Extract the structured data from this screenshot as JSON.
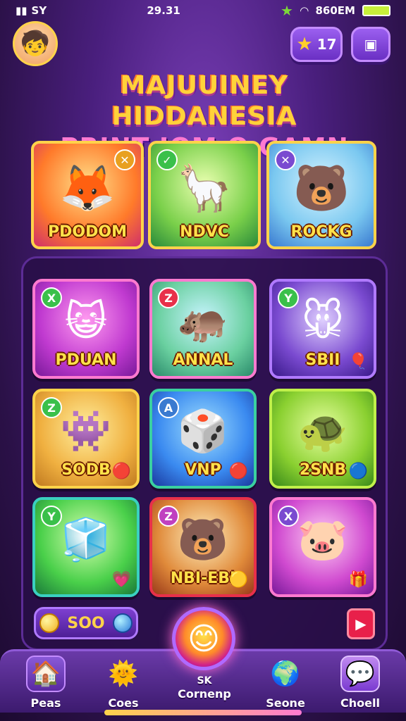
{
  "status": {
    "carrier": "SY",
    "time": "29.31",
    "battery_text": "860EM"
  },
  "header": {
    "stars_count": "17"
  },
  "title": {
    "line1": "MAJUUINEY HIDDANESIA",
    "line2": "PRINT IOM O GAMN"
  },
  "featured": [
    {
      "label": "PDODOM",
      "icon": "fox-icon",
      "badge": "✕"
    },
    {
      "label": "NDVC",
      "icon": "alpaca-icon",
      "badge": "✓"
    },
    {
      "label": "ROCKG",
      "icon": "bear-icon",
      "badge": "✕"
    }
  ],
  "tiles": [
    {
      "label": "PDUAN",
      "icon": "cat-icon",
      "badge": "X"
    },
    {
      "label": "ANNAL",
      "icon": "hippo-icon",
      "badge": "Z"
    },
    {
      "label": "SBII",
      "icon": "rat-icon",
      "badge": "Y"
    },
    {
      "label": "SODB",
      "icon": "monster-icon",
      "badge": "Z"
    },
    {
      "label": "VNP",
      "icon": "gem-cube-icon",
      "badge": "A"
    },
    {
      "label": "2SNB",
      "icon": "turtle-icon",
      "badge": ""
    },
    {
      "label": "",
      "icon": "gem-cube-icon",
      "badge": "Y"
    },
    {
      "label": "NBI-EBI",
      "icon": "bear-icon",
      "badge": "Z"
    },
    {
      "label": "",
      "icon": "pig-icon",
      "badge": "X"
    }
  ],
  "score": {
    "value": "SOO"
  },
  "nav": {
    "items": [
      {
        "label": "Peas",
        "icon": "home-icon"
      },
      {
        "label": "Coes",
        "icon": "sun-icon"
      },
      {
        "label": "Seone",
        "icon": "globe-icon"
      },
      {
        "label": "Choell",
        "icon": "chat-icon"
      }
    ],
    "center_sub": "SK",
    "center_label": "Cornenp"
  },
  "colors": {
    "accent": "#ffd34a",
    "bg": "#4a1f7e",
    "play": "#e8204a"
  }
}
